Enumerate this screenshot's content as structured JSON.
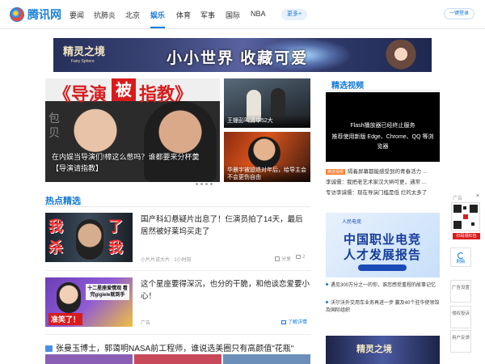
{
  "header": {
    "logo_text": "腾讯网",
    "nav": [
      "要闻",
      "抗肺炎",
      "北京",
      "娱乐",
      "体育",
      "军事",
      "国际",
      "NBA"
    ],
    "active_nav": "娱乐",
    "more_label": "更多+",
    "login_label": "一键登录"
  },
  "banner": {
    "logo": "精灵之境",
    "logo_sub": "Fairy Sphere",
    "text": "小小世界 收藏可爱"
  },
  "hero": {
    "title_red": "《导演",
    "title_badge": "被",
    "title_black": "指教》",
    "side_text": "包贝",
    "caption": "在内娱当导演们!樟这么憋吗？谁都要来分杯羹【导演请指教】"
  },
  "thumbs": [
    {
      "caption": "王姗彭叫清华52大"
    },
    {
      "caption": "华晨宇被迫退对年后，给导主会不会更伤自由"
    }
  ],
  "section": {
    "title": "热点精选"
  },
  "news": [
    {
      "title": "国产科幻悬疑片出息了！仨演员拍了14天，最后居然被好莱坞买走了",
      "source": "小片片说大片",
      "time": "1小时前",
      "share_label": "分享",
      "comments": "2",
      "img_text_left": "我杀",
      "img_text_right": "了我"
    },
    {
      "title": "这个星座要得深沉，也分的干脆，和他谈恋爱要小心！",
      "ad_label": "广告",
      "detail_label": "了解详情",
      "img_box_text": "十二星座爱情观 看完gigiele就到手",
      "img_tag": "准笑了！"
    }
  ],
  "gallery": {
    "title": "张曼玉博士，郭蔼明NASA前工程师，谁说选美圈只有高颜值\"花瓶\""
  },
  "right": {
    "title": "精选视频",
    "flash_line1": "Flash播放器已经终止服务",
    "flash_line2": "推荐使用新版 Edge、Chrome、QQ 等浏览器",
    "videos": [
      {
        "tag": "精选视频",
        "text": "隔着屏幕都能感受到的青春活力 ..."
      },
      {
        "tag": "",
        "text": "李诚儒：我把老艺术家汉大辫可更，通常 ..."
      },
      {
        "tag": "",
        "text": "专访李诚儒：现在导演门槛是低 烂的太多了"
      }
    ],
    "ad": {
      "brand": "人民电竞",
      "line1": "中国职业电竞",
      "line2": "人才发展报告",
      "bullets": [
        "遇见300万分之一的你，谁您感受重程的故事记忆",
        "沃尔沃外交用车业务再进一步 赢及40个驻华使领馆及国际组织"
      ]
    }
  },
  "side": {
    "ad_label": "广告",
    "close": "×",
    "red_label": "扫码领红包",
    "refresh": "刷新",
    "ad_setting": "广告设置",
    "report": "侵权投诉",
    "feedback": "用户反馈"
  }
}
